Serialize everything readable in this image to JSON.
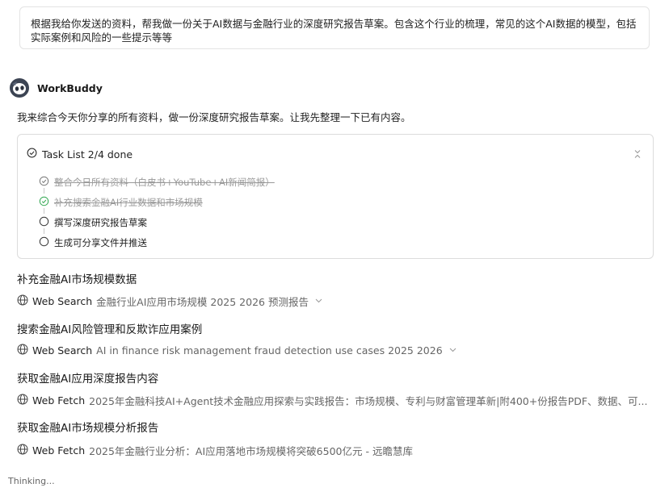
{
  "user_message": "根据我给你发送的资料，帮我做一份关于AI数据与金融行业的深度研究报告草案。包含这个行业的梳理，常见的这个AI数据的模型，包括实际案例和风险的一些提示等等",
  "agent": {
    "name": "WorkBuddy",
    "intro": "我来综合今天你分享的所有资料，做一份深度研究报告草案。让我先整理一下已有内容。"
  },
  "task_list": {
    "title": "Task List 2/4 done",
    "items": [
      {
        "label": "整合今日所有资料（白皮书+YouTube+AI新闻简报）",
        "status": "done"
      },
      {
        "label": "补充搜索金融AI行业数据和市场规模",
        "status": "done"
      },
      {
        "label": "撰写深度研究报告草案",
        "status": "pending"
      },
      {
        "label": "生成可分享文件并推送",
        "status": "pending"
      }
    ]
  },
  "steps": [
    {
      "title": "补充金融AI市场规模数据",
      "tool": "Web Search",
      "query": "金融行业AI应用市场规模 2025 2026 预测报告",
      "expandable": true
    },
    {
      "title": "搜索金融AI风险管理和反欺诈应用案例",
      "tool": "Web Search",
      "query": "AI in finance risk management fraud detection use cases 2025 2026",
      "expandable": true
    },
    {
      "title": "获取金融AI应用深度报告内容",
      "tool": "Web Fetch",
      "query": "2025年金融科技AI+Agent技术金融应用探索与实践报告：市场规模、专利与财富管理革新|附400+份报告PDF、数据、可...",
      "expandable": false
    },
    {
      "title": "获取金融AI市场规模分析报告",
      "tool": "Web Fetch",
      "query": "2025年金融行业分析：AI应用落地市场规模将突破6500亿元 - 远瞻慧库",
      "expandable": false
    }
  ],
  "status": "Thinking...",
  "colors": {
    "done_check": "#34a853",
    "muted": "#999999",
    "border": "#dcdcdc"
  },
  "icons": {
    "task_list": "check-circle-icon",
    "collapse": "collapse-icon",
    "tool": "globe-icon",
    "caret": "chevron-down-icon"
  }
}
